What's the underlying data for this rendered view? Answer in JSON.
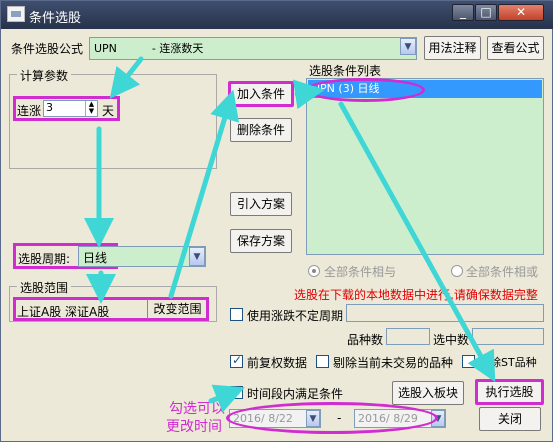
{
  "window": {
    "title": "条件选股",
    "min": "_",
    "max": "□",
    "close": "✕"
  },
  "formula": {
    "label": "条件选股公式",
    "value": "UPN          - 连涨数天",
    "usage_btn": "用法注释",
    "view_btn": "查看公式"
  },
  "params": {
    "group_title": "计算参数",
    "prefix": "连涨",
    "value": "3",
    "suffix": "天"
  },
  "period": {
    "label": "选股周期:",
    "value": "日线"
  },
  "range": {
    "group_title": "选股范围",
    "markets": "上证A股 深证A股",
    "change_btn": "改变范围"
  },
  "actions": {
    "add": "加入条件",
    "delete": "删除条件",
    "import": "引入方案",
    "save": "保存方案"
  },
  "conditions": {
    "label": "选股条件列表",
    "items": [
      "UPN (3) 日线"
    ]
  },
  "logic": {
    "and": "全部条件相与",
    "or": "全部条件相或"
  },
  "warning": "选股在下载的本地数据中进行,请确保数据完整",
  "options": {
    "indef_period": "使用涨跌不定周期",
    "count_label": "品种数",
    "selected_label": "选中数",
    "prior_adjust": "前复权数据",
    "exclude_untraded": "剔除当前未交易的品种",
    "exclude_st": "剔除ST品种",
    "time_range": "时间段内满足条件"
  },
  "dates": {
    "start": "2016/ 8/22",
    "sep": "-",
    "end": "2016/ 8/29"
  },
  "bottom": {
    "to_block": "选股入板块",
    "execute": "执行选股",
    "close": "关闭"
  },
  "annotation": {
    "line1": "勾选可以",
    "line2": "更改时间"
  },
  "colors": {
    "highlight": "#d02cd0",
    "arrow": "#3fd6d6",
    "selection": "#3399ff",
    "warning": "#e00000"
  }
}
